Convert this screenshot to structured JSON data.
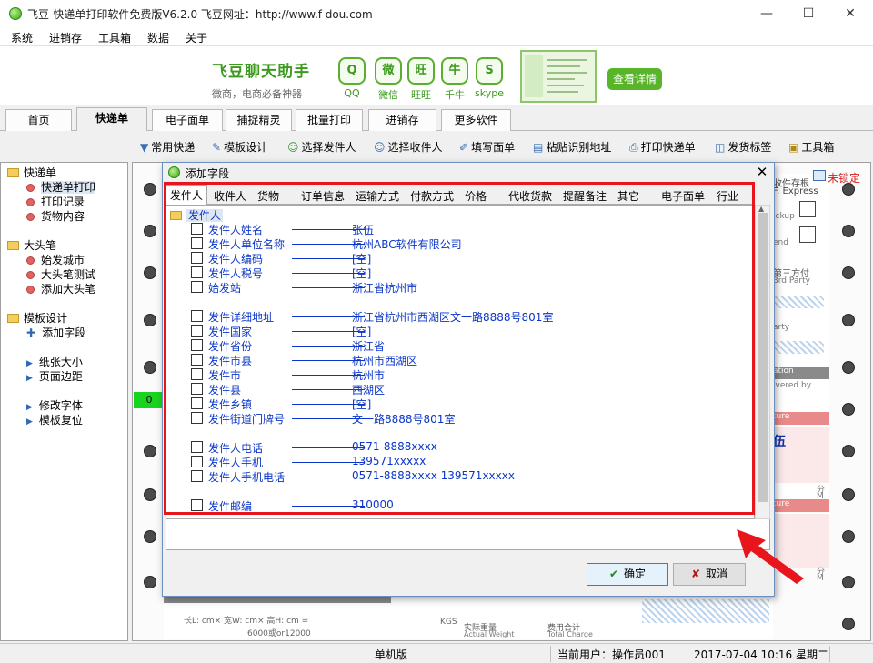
{
  "window": {
    "title": "飞豆-快递单打印软件免费版V6.2.0   飞豆网址：http://www.f-dou.com",
    "min": "—",
    "max": "☐",
    "close": "✕"
  },
  "menu": [
    "系统",
    "进销存",
    "工具箱",
    "数据",
    "关于"
  ],
  "banner": {
    "title": "飞豆聊天助手",
    "subtitle": "微商，电商必备神器",
    "apps": [
      {
        "label": "QQ",
        "glyph": "Q"
      },
      {
        "label": "微信",
        "glyph": "微"
      },
      {
        "label": "旺旺",
        "glyph": "旺"
      },
      {
        "label": "千牛",
        "glyph": "牛"
      },
      {
        "label": "skype",
        "glyph": "S"
      }
    ],
    "details_button": "查看详情"
  },
  "tabs": [
    "首页",
    "快递单",
    "电子面单",
    "捕捉精灵",
    "批量打印",
    "进销存",
    "更多软件"
  ],
  "active_tab": "快递单",
  "toolbar": [
    {
      "label": "常用快递",
      "icon": "dropdown-arrow-icon",
      "glyph": "▼"
    },
    {
      "label": "模板设计",
      "icon": "design-ruler-icon",
      "glyph": "✎"
    },
    {
      "label": "选择发件人",
      "icon": "sender-person-icon",
      "glyph": "☺"
    },
    {
      "label": "选择收件人",
      "icon": "recipient-person-icon",
      "glyph": "☺"
    },
    {
      "label": "填写面单",
      "icon": "pen-icon",
      "glyph": "✐"
    },
    {
      "label": "粘贴识别地址",
      "icon": "clipboard-icon",
      "glyph": "▤"
    },
    {
      "label": "打印快递单",
      "icon": "printer-icon",
      "glyph": "⎙"
    },
    {
      "label": "发货标签",
      "icon": "tag-icon",
      "glyph": "◫"
    },
    {
      "label": "工具箱",
      "icon": "toolbox-icon",
      "glyph": "▣"
    }
  ],
  "tree": {
    "groups": [
      {
        "label": "快递单",
        "items": [
          {
            "label": "快递单打印",
            "mark": "bullet"
          },
          {
            "label": "打印记录",
            "mark": "bullet"
          },
          {
            "label": "货物内容",
            "mark": "bullet"
          }
        ]
      },
      {
        "label": "大头笔",
        "items": [
          {
            "label": "始发城市",
            "mark": "bullet"
          },
          {
            "label": "大头笔测试",
            "mark": "bullet"
          },
          {
            "label": "添加大头笔",
            "mark": "bullet"
          }
        ]
      },
      {
        "label": "模板设计",
        "items": [
          {
            "label": "添加字段",
            "mark": "plus"
          }
        ]
      }
    ],
    "extra": [
      {
        "label": "纸张大小"
      },
      {
        "label": "页面边距"
      },
      {
        "label": "修改字体"
      },
      {
        "label": "模板复位"
      }
    ]
  },
  "canvas": {
    "lock_label": "未锁定",
    "marker": "0",
    "bits": [
      "收件存根",
      "F. Express",
      "ickup",
      "end",
      "第三方付",
      "3rd Party",
      "arty",
      "ation",
      "ivered by",
      "ture",
      "伍",
      "ture",
      "分",
      "M",
      "分",
      "M",
      "实际重量",
      "Actual Weight",
      "费用合计",
      "Total Charge",
      "KGS",
      "长L:    cm× 宽W:    cm× 高H:    cm =",
      "6000或or12000"
    ]
  },
  "status": {
    "mode": "单机版",
    "user": "当前用户：操作员001",
    "datetime": "2017-07-04 10:16 星期二"
  },
  "dialog": {
    "title": "添加字段",
    "close": "✕",
    "tabs": [
      "发件人",
      "收件人",
      "货物",
      "订单信息",
      "运输方式",
      "付款方式",
      "价格",
      "代收货款",
      "提醒备注",
      "其它",
      "电子面单",
      "行业"
    ],
    "root": "发件人",
    "fields": [
      {
        "name": "发件人姓名",
        "value": "张伍"
      },
      {
        "name": "发件人单位名称",
        "value": "杭州ABC软件有限公司"
      },
      {
        "name": "发件人编码",
        "value": "[空]"
      },
      {
        "name": "发件人税号",
        "value": "[空]"
      },
      {
        "name": "始发站",
        "value": "浙江省杭州市"
      },
      {
        "name": "",
        "value": ""
      },
      {
        "name": "发件详细地址",
        "value": "浙江省杭州市西湖区文一路8888号801室"
      },
      {
        "name": "发件国家",
        "value": "[空]"
      },
      {
        "name": "发件省份",
        "value": "浙江省"
      },
      {
        "name": "发件市县",
        "value": "杭州市西湖区"
      },
      {
        "name": "发件市",
        "value": "杭州市"
      },
      {
        "name": "发件县",
        "value": "西湖区"
      },
      {
        "name": "发件乡镇",
        "value": "[空]"
      },
      {
        "name": "发件街道门牌号",
        "value": "文一路8888号801室"
      },
      {
        "name": "",
        "value": ""
      },
      {
        "name": "发件人电话",
        "value": "0571-8888xxxx"
      },
      {
        "name": "发件人手机",
        "value": "139571xxxxx"
      },
      {
        "name": "发件人手机电话",
        "value": "0571-8888xxxx 139571xxxxx"
      },
      {
        "name": "",
        "value": ""
      },
      {
        "name": "发件邮编",
        "value": "310000"
      }
    ],
    "ok": "确定",
    "cancel": "取消"
  }
}
